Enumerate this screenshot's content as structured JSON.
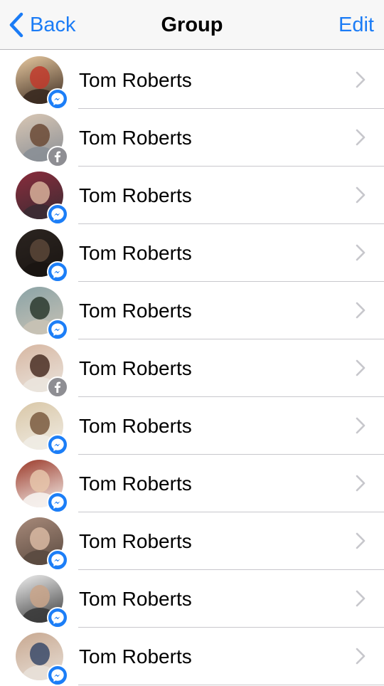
{
  "nav": {
    "back_label": "Back",
    "title": "Group",
    "edit_label": "Edit",
    "accent_color": "#1b7cf6"
  },
  "members": [
    {
      "name": "Tom Roberts",
      "badge": "messenger-icon",
      "avatar_colors": [
        "#e8c9a0",
        "#c0392b",
        "#3a2a20"
      ]
    },
    {
      "name": "Tom Roberts",
      "badge": "facebook-icon",
      "avatar_colors": [
        "#d9c7b4",
        "#6b4a36",
        "#8a8f96"
      ]
    },
    {
      "name": "Tom Roberts",
      "badge": "messenger-icon",
      "avatar_colors": [
        "#8a2c3c",
        "#d7b09a",
        "#3b2b33"
      ]
    },
    {
      "name": "Tom Roberts",
      "badge": "messenger-icon",
      "avatar_colors": [
        "#2b2420",
        "#5a4638",
        "#1a1512"
      ]
    },
    {
      "name": "Tom Roberts",
      "badge": "messenger-icon",
      "avatar_colors": [
        "#8aa3a6",
        "#2c3a2e",
        "#c8c2b5"
      ]
    },
    {
      "name": "Tom Roberts",
      "badge": "facebook-icon",
      "avatar_colors": [
        "#d7b7a2",
        "#4a2f25",
        "#eae4dd"
      ]
    },
    {
      "name": "Tom Roberts",
      "badge": "messenger-icon",
      "avatar_colors": [
        "#d9c7a7",
        "#7a5a3f",
        "#f0ece4"
      ]
    },
    {
      "name": "Tom Roberts",
      "badge": "messenger-icon",
      "avatar_colors": [
        "#9b3a2a",
        "#e6c5aa",
        "#f6f2ee"
      ]
    },
    {
      "name": "Tom Roberts",
      "badge": "messenger-icon",
      "avatar_colors": [
        "#a88a7a",
        "#d8b9a2",
        "#5a4a40"
      ]
    },
    {
      "name": "Tom Roberts",
      "badge": "messenger-icon",
      "avatar_colors": [
        "#efefef",
        "#c9a48a",
        "#3a3a3a"
      ]
    },
    {
      "name": "Tom Roberts",
      "badge": "messenger-icon",
      "avatar_colors": [
        "#c8a890",
        "#3a4a6a",
        "#e8e0d8"
      ]
    }
  ]
}
